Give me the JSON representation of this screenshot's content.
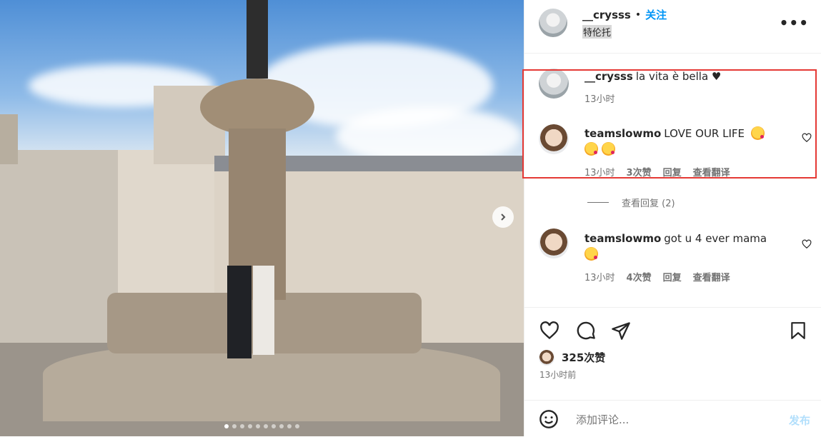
{
  "post": {
    "username": "__crysss",
    "separator": "•",
    "follow_label": "关注",
    "location": "特伦托",
    "more_label": "•••"
  },
  "comments": [
    {
      "username": "__crysss",
      "text": "la vita è bella ♥",
      "time": "13小时"
    },
    {
      "username": "teamslowmo",
      "text": "LOVE OUR LIFE",
      "time": "13小时",
      "likes": "3次赞",
      "reply": "回复",
      "translate": "查看翻译"
    },
    {
      "username": "teamslowmo",
      "text": "got u 4 ever mama",
      "time": "13小时",
      "likes": "4次赞",
      "reply": "回复",
      "translate": "查看翻译"
    }
  ],
  "view_replies": "查看回复 (2)",
  "likes_count": "325次赞",
  "posted_ago": "13小时前",
  "add_comment": {
    "placeholder": "添加评论...",
    "post_label": "发布"
  },
  "carousel": {
    "slides": 10,
    "active_index": 0
  },
  "colors": {
    "accent": "#0095f6",
    "highlight_box": "#e53935",
    "text": "#262626",
    "muted": "#737373"
  },
  "icons": [
    "heart-icon",
    "comment-icon",
    "share-icon",
    "bookmark-icon",
    "emoji-icon",
    "chevron-right-icon"
  ]
}
